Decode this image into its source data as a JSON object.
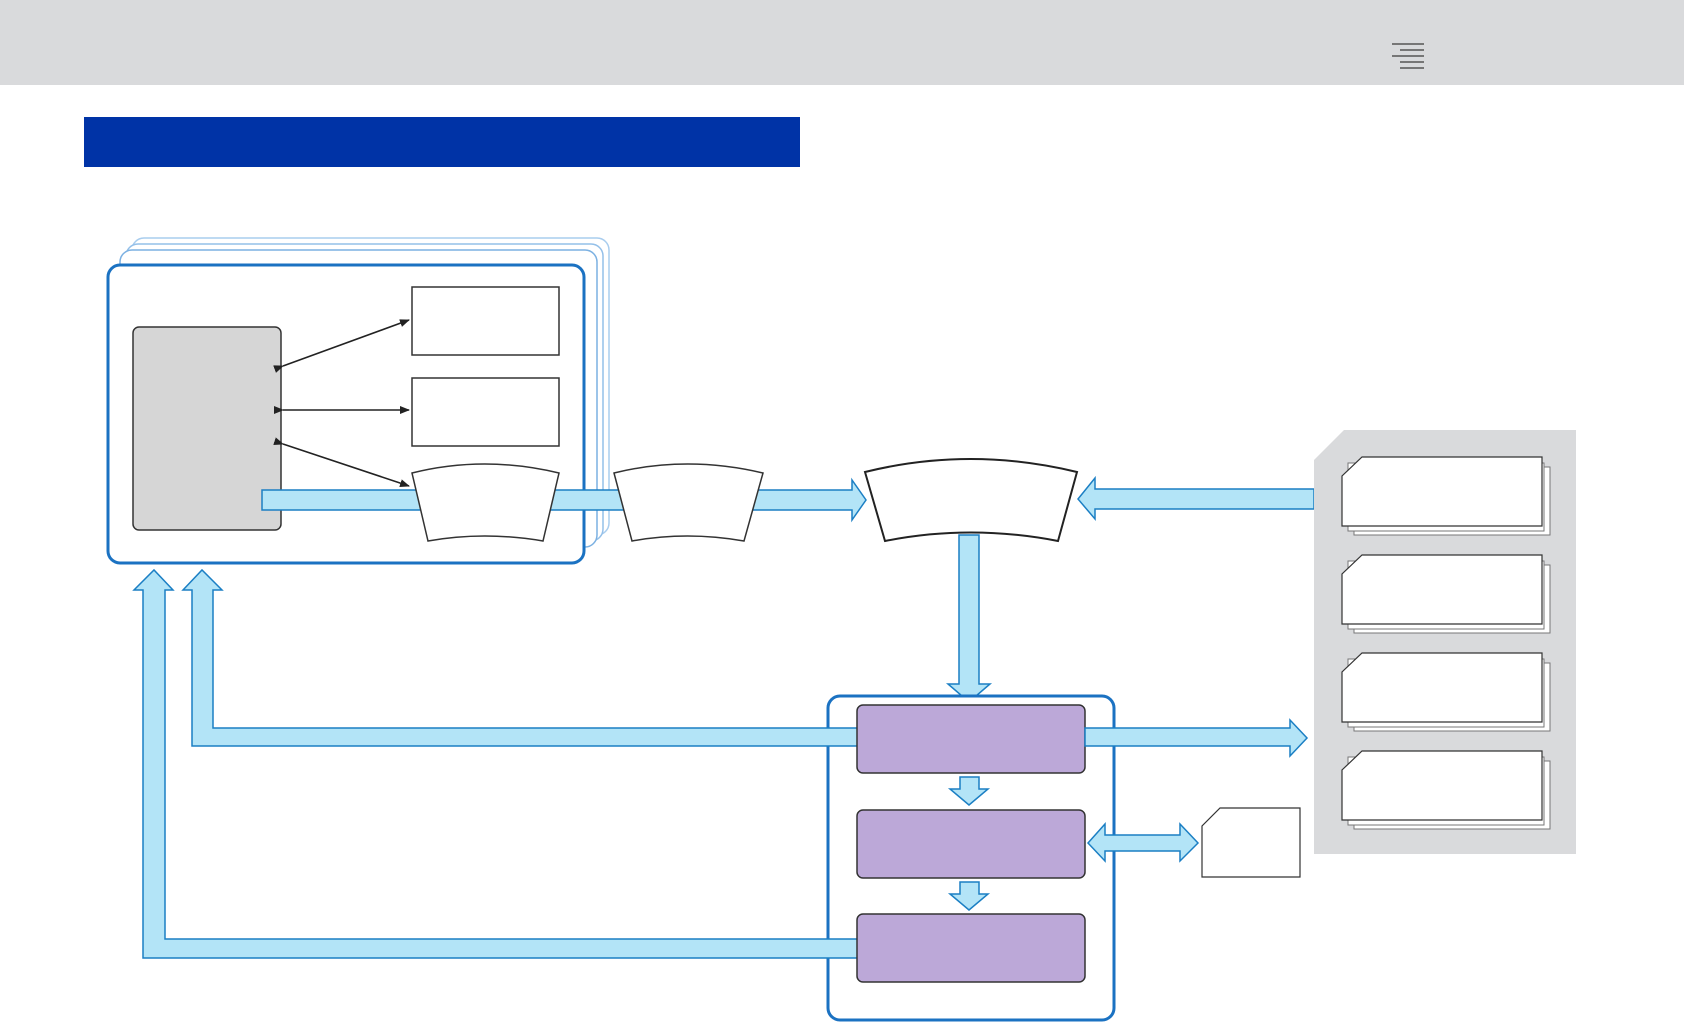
{
  "header": {
    "menu_icon": "menu-lines-icon"
  },
  "banner": {
    "title": ""
  },
  "colors": {
    "topbar": "#d9dadc",
    "banner": "#0033a6",
    "flow_arrow_fill": "#b3e4f7",
    "flow_arrow_stroke": "#1b7fc4",
    "container_stroke": "#1b72c2",
    "container_stack": "#8fbde6",
    "gray_block": "#d6d6d6",
    "purple_block": "#bca8d8",
    "right_panel": "#d9dadc"
  },
  "diagram": {
    "nodes": [
      {
        "id": "source-container",
        "label": ""
      },
      {
        "id": "gray-block",
        "label": ""
      },
      {
        "id": "box-1",
        "label": ""
      },
      {
        "id": "box-2",
        "label": ""
      },
      {
        "id": "curved-box-1",
        "label": ""
      },
      {
        "id": "curved-box-2",
        "label": ""
      },
      {
        "id": "curved-box-center",
        "label": ""
      },
      {
        "id": "process-container",
        "label": ""
      },
      {
        "id": "purple-block-1",
        "label": ""
      },
      {
        "id": "purple-block-2",
        "label": ""
      },
      {
        "id": "purple-block-3",
        "label": ""
      },
      {
        "id": "card-small",
        "label": ""
      },
      {
        "id": "right-panel",
        "label": ""
      },
      {
        "id": "card-1",
        "label": ""
      },
      {
        "id": "card-2",
        "label": ""
      },
      {
        "id": "card-3",
        "label": ""
      },
      {
        "id": "card-4",
        "label": ""
      }
    ]
  }
}
